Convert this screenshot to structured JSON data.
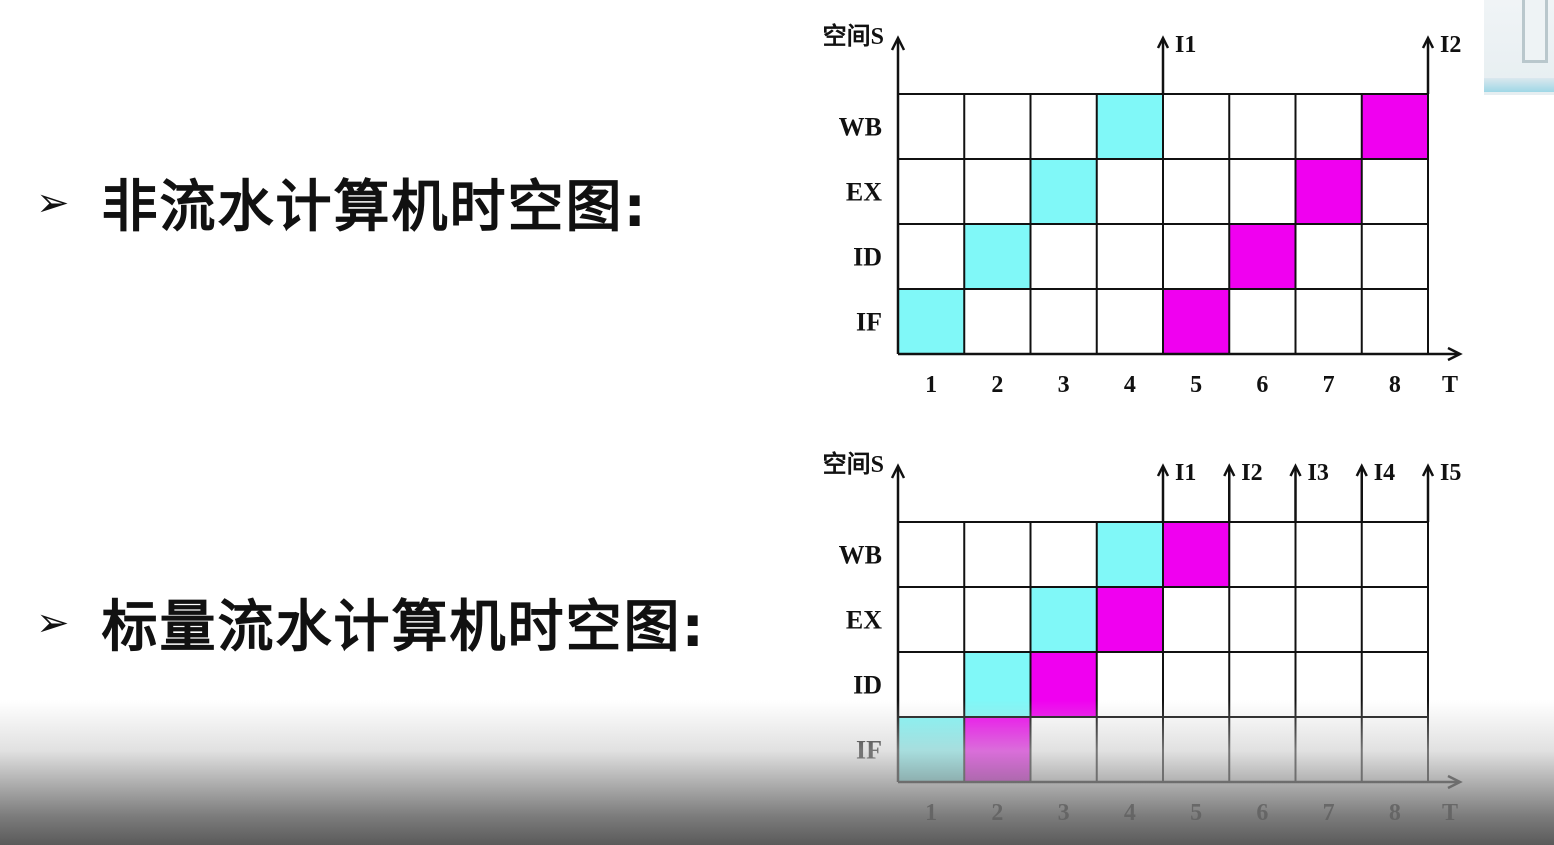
{
  "bullets": [
    {
      "marker": "➢",
      "text": "非流水计算机时空图:"
    },
    {
      "marker": "➢",
      "text": "标量流水计算机时空图:"
    }
  ],
  "colors": {
    "cyan": "#80f8f8",
    "magenta": "#f000f0",
    "grid": "#111111"
  },
  "diagrams": [
    {
      "y_axis_label": "空间S",
      "x_axis_label": "T",
      "stages": [
        "WB",
        "EX",
        "ID",
        "IF"
      ],
      "time_labels": [
        "1",
        "2",
        "3",
        "4",
        "5",
        "6",
        "7",
        "8"
      ],
      "instruction_labels": [
        "I1",
        "I2"
      ],
      "instruction_marker_columns": [
        4,
        8
      ],
      "cells": [
        {
          "stage": "IF",
          "t": 1,
          "color": "cyan"
        },
        {
          "stage": "ID",
          "t": 2,
          "color": "cyan"
        },
        {
          "stage": "EX",
          "t": 3,
          "color": "cyan"
        },
        {
          "stage": "WB",
          "t": 4,
          "color": "cyan"
        },
        {
          "stage": "IF",
          "t": 5,
          "color": "magenta"
        },
        {
          "stage": "ID",
          "t": 6,
          "color": "magenta"
        },
        {
          "stage": "EX",
          "t": 7,
          "color": "magenta"
        },
        {
          "stage": "WB",
          "t": 8,
          "color": "magenta"
        }
      ]
    },
    {
      "y_axis_label": "空间S",
      "x_axis_label": "T",
      "stages": [
        "WB",
        "EX",
        "ID",
        "IF"
      ],
      "time_labels": [
        "1",
        "2",
        "3",
        "4",
        "5",
        "6",
        "7",
        "8"
      ],
      "instruction_labels": [
        "I1",
        "I2",
        "I3",
        "I4",
        "I5"
      ],
      "instruction_marker_columns": [
        4,
        5,
        6,
        7,
        8
      ],
      "cells": [
        {
          "stage": "IF",
          "t": 1,
          "color": "cyan"
        },
        {
          "stage": "ID",
          "t": 2,
          "color": "cyan"
        },
        {
          "stage": "EX",
          "t": 3,
          "color": "cyan"
        },
        {
          "stage": "WB",
          "t": 4,
          "color": "cyan"
        },
        {
          "stage": "IF",
          "t": 2,
          "color": "magenta"
        },
        {
          "stage": "ID",
          "t": 3,
          "color": "magenta"
        },
        {
          "stage": "EX",
          "t": 4,
          "color": "magenta"
        },
        {
          "stage": "WB",
          "t": 5,
          "color": "magenta"
        }
      ]
    }
  ]
}
